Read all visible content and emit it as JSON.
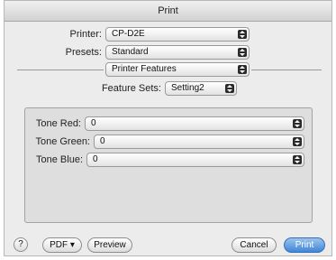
{
  "window": {
    "title": "Print"
  },
  "printer": {
    "label": "Printer:",
    "value": "CP-D2E"
  },
  "presets": {
    "label": "Presets:",
    "value": "Standard"
  },
  "section": {
    "value": "Printer Features"
  },
  "feature_sets": {
    "label": "Feature Sets:",
    "value": "Setting2"
  },
  "tones": [
    {
      "label": "Tone Red:",
      "value": "0"
    },
    {
      "label": "Tone Green:",
      "value": "0"
    },
    {
      "label": "Tone Blue:",
      "value": "0"
    }
  ],
  "footer": {
    "help": "?",
    "pdf": "PDF ▾",
    "preview": "Preview",
    "cancel": "Cancel",
    "print": "Print"
  }
}
